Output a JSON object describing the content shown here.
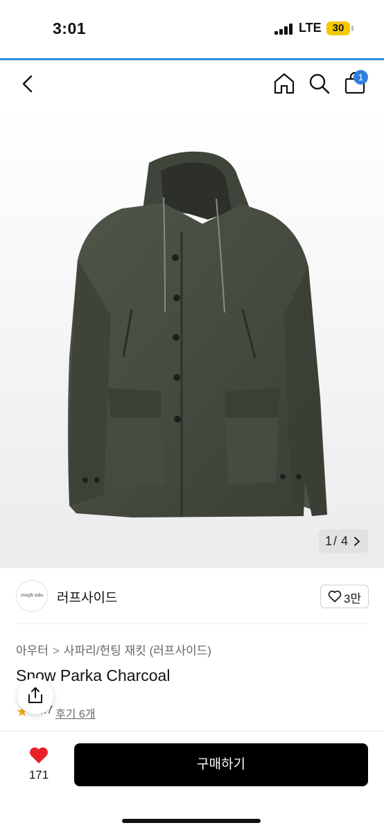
{
  "status_bar": {
    "time": "3:01",
    "network": "LTE",
    "battery": "30"
  },
  "nav": {
    "back_icon": "chevron-left-icon",
    "home_icon": "home-icon",
    "search_icon": "search-icon",
    "cart_icon": "bag-icon",
    "cart_count": "1",
    "accent": "#2f8dd6"
  },
  "gallery": {
    "current": "1",
    "separator": "/",
    "total": "4",
    "next_icon": "chevron-right-icon"
  },
  "brand": {
    "logo_text": "rough side",
    "name": "러프사이드",
    "likes": "3만"
  },
  "breadcrumb": {
    "category": "아우터",
    "separator": ">",
    "subcategory": "사파리/헌팅 재킷 (러프사이드)"
  },
  "product": {
    "title": "Snow Parka Charcoal",
    "rating": "4.7",
    "reviews": "후기 6개"
  },
  "bottom": {
    "wish_count": "171",
    "buy_label": "구매하기",
    "heart_color": "#e8202a"
  }
}
